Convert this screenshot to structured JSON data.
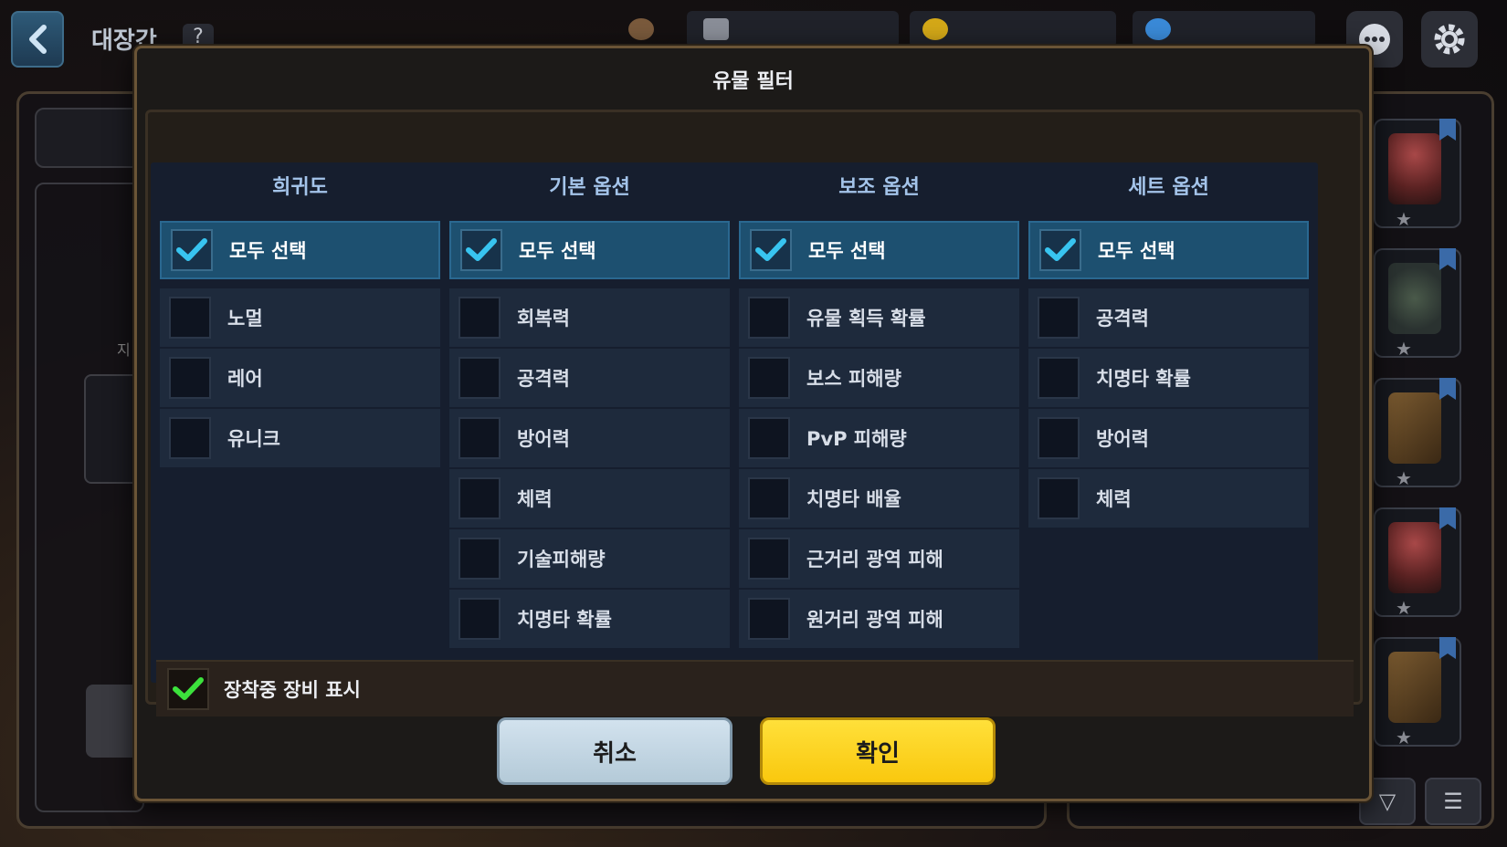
{
  "background": {
    "screen_title": "대장간",
    "help_label": "?",
    "side_text": "지"
  },
  "modal": {
    "title": "유물 필터",
    "columns": [
      {
        "header": "희귀도",
        "items": [
          {
            "label": "모두 선택",
            "checked": true
          },
          {
            "label": "노멀",
            "checked": false
          },
          {
            "label": "레어",
            "checked": false
          },
          {
            "label": "유니크",
            "checked": false
          }
        ]
      },
      {
        "header": "기본 옵션",
        "items": [
          {
            "label": "모두 선택",
            "checked": true
          },
          {
            "label": "회복력",
            "checked": false
          },
          {
            "label": "공격력",
            "checked": false
          },
          {
            "label": "방어력",
            "checked": false
          },
          {
            "label": "체력",
            "checked": false
          },
          {
            "label": "기술피해량",
            "checked": false
          },
          {
            "label": "치명타 확률",
            "checked": false
          }
        ]
      },
      {
        "header": "보조 옵션",
        "items": [
          {
            "label": "모두 선택",
            "checked": true
          },
          {
            "label": "유물 획득 확률",
            "checked": false
          },
          {
            "label": "보스 피해량",
            "checked": false
          },
          {
            "label": "PvP 피해량",
            "checked": false
          },
          {
            "label": "치명타 배율",
            "checked": false
          },
          {
            "label": "근거리 광역 피해",
            "checked": false
          },
          {
            "label": "원거리 광역 피해",
            "checked": false
          }
        ]
      },
      {
        "header": "세트 옵션",
        "items": [
          {
            "label": "모두 선택",
            "checked": true
          },
          {
            "label": "공격력",
            "checked": false
          },
          {
            "label": "치명타 확률",
            "checked": false
          },
          {
            "label": "방어력",
            "checked": false
          },
          {
            "label": "체력",
            "checked": false
          }
        ]
      }
    ],
    "show_equipped": {
      "label": "장착중 장비 표시",
      "checked": true
    },
    "cancel_label": "취소",
    "confirm_label": "확인"
  },
  "colors": {
    "check_blue": "#38c4f0",
    "check_green": "#3ce23c",
    "confirm_yellow": "#ffd21e",
    "cancel_blue": "#c2d6e4"
  }
}
